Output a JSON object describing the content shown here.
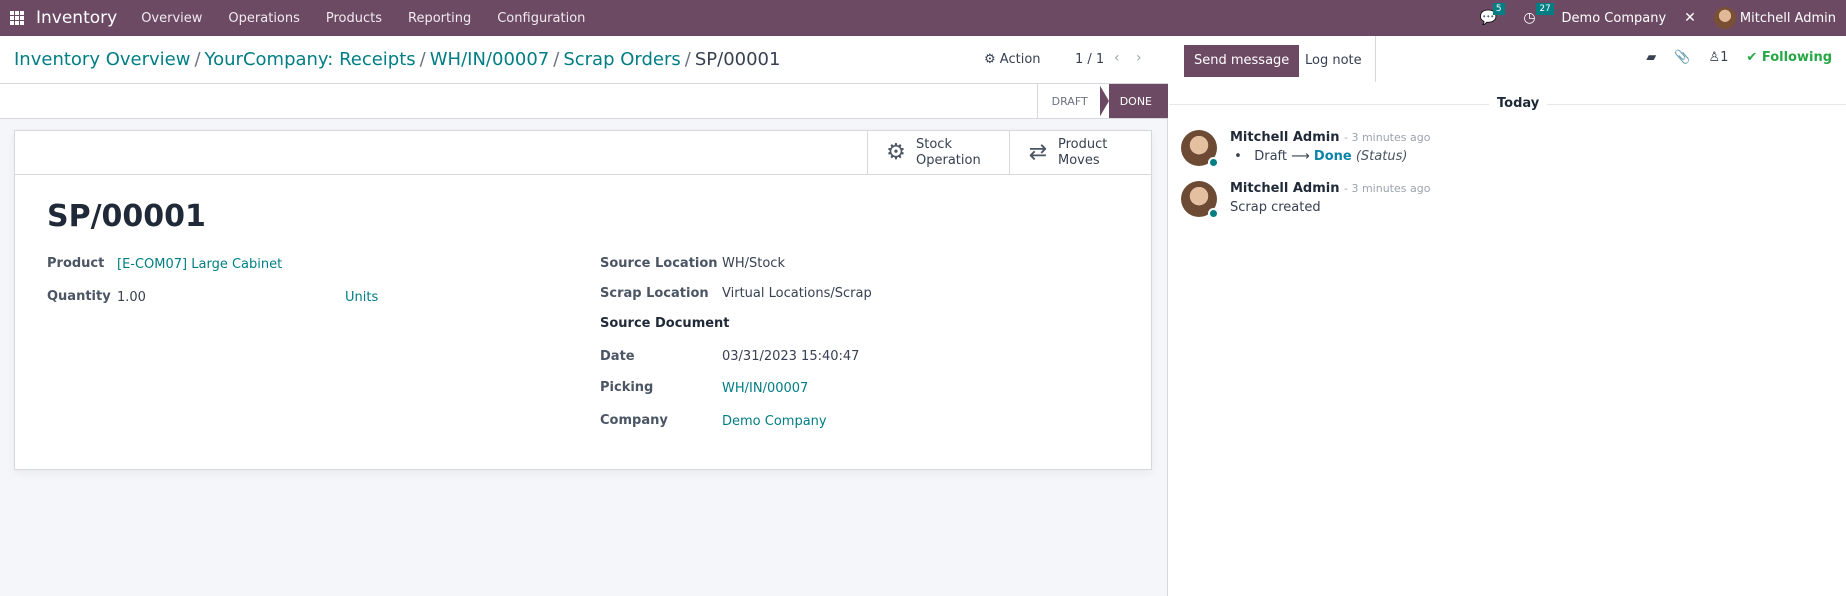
{
  "navbar": {
    "app_name": "Inventory",
    "menu": [
      "Overview",
      "Operations",
      "Products",
      "Reporting",
      "Configuration"
    ],
    "messages_count": "5",
    "activities_count": "27",
    "company": "Demo Company",
    "user": "Mitchell Admin"
  },
  "control_panel": {
    "breadcrumbs": [
      "Inventory Overview",
      "YourCompany: Receipts",
      "WH/IN/00007",
      "Scrap Orders"
    ],
    "current": "SP/00001",
    "action_label": "Action",
    "pager": "1 / 1"
  },
  "statusbar": {
    "stages": [
      "DRAFT",
      "DONE"
    ],
    "active": "DONE"
  },
  "smart_buttons": {
    "stock_operation": [
      "Stock",
      "Operation"
    ],
    "product_moves": [
      "Product",
      "Moves"
    ]
  },
  "record": {
    "title": "SP/00001",
    "left_fields": {
      "product_label": "Product",
      "product_value": "[E-COM07] Large Cabinet",
      "quantity_label": "Quantity",
      "quantity_value": "1.00",
      "uom_value": "Units"
    },
    "right_fields": {
      "source_location_label": "Source Location",
      "source_location_value": "WH/Stock",
      "scrap_location_label": "Scrap Location",
      "scrap_location_value": "Virtual Locations/Scrap",
      "source_document_label": "Source Document",
      "date_label": "Date",
      "date_value": "03/31/2023 15:40:47",
      "picking_label": "Picking",
      "picking_value": "WH/IN/00007",
      "company_label": "Company",
      "company_value": "Demo Company"
    }
  },
  "chatter": {
    "send_message": "Send message",
    "log_note": "Log note",
    "followers_count": "1",
    "following": "Following",
    "date_separator": "Today",
    "messages": [
      {
        "author": "Mitchell Admin",
        "date": "- 3 minutes ago",
        "tracking_old": "Draft",
        "tracking_arrow": "⟶",
        "tracking_new": "Done",
        "tracking_field": "(Status)"
      },
      {
        "author": "Mitchell Admin",
        "date": "- 3 minutes ago",
        "body": "Scrap created"
      }
    ]
  },
  "colors": {
    "brand": "#6c4a63",
    "link": "#017e84",
    "following": "#28a745"
  }
}
